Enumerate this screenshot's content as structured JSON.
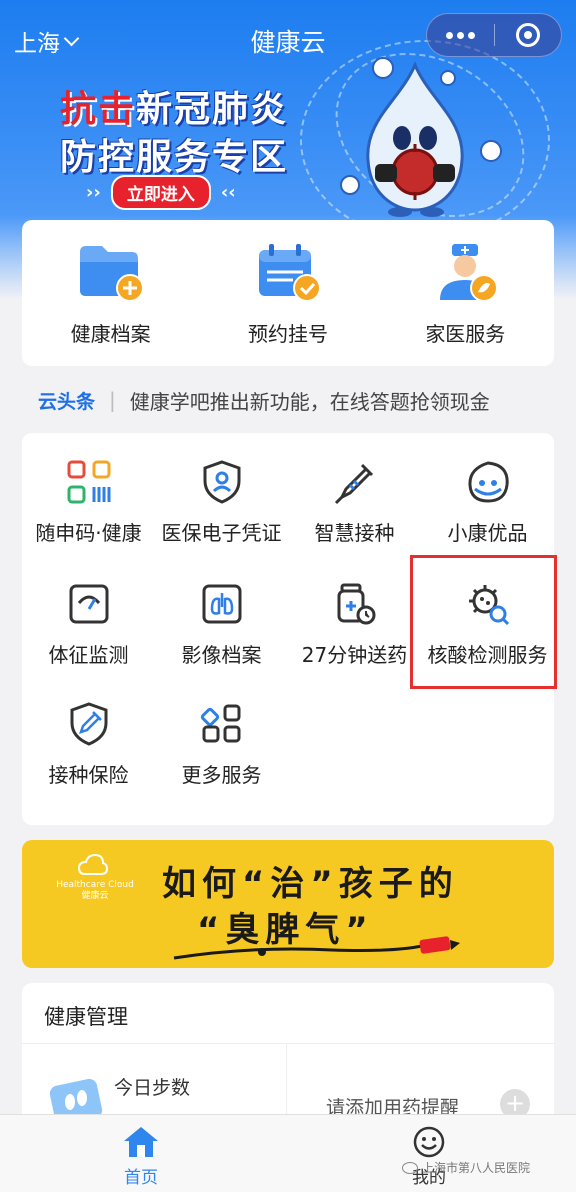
{
  "header": {
    "city": "上海",
    "title": "健康云"
  },
  "banner": {
    "line1_red": "抗击",
    "line1_rest": "新冠肺炎",
    "line2": "防控服务专区",
    "arrows_left": "››",
    "enter_label": "立即进入",
    "arrows_right": "‹‹"
  },
  "quick_actions": [
    {
      "label": "健康档案",
      "icon": "folder-plus-icon"
    },
    {
      "label": "预约挂号",
      "icon": "calendar-check-icon"
    },
    {
      "label": "家医服务",
      "icon": "doctor-icon"
    }
  ],
  "news": {
    "brand": "云头条",
    "separator": "|",
    "text": "健康学吧推出新功能，在线答题抢领现金"
  },
  "services": [
    {
      "label": "随申码·健康",
      "icon": "qr-code-icon"
    },
    {
      "label": "医保电子凭证",
      "icon": "shield-user-icon"
    },
    {
      "label": "智慧接种",
      "icon": "syringe-icon"
    },
    {
      "label": "小康优品",
      "icon": "mascot-icon"
    },
    {
      "label": "体征监测",
      "icon": "gauge-icon"
    },
    {
      "label": "影像档案",
      "icon": "lungs-icon"
    },
    {
      "label": "27分钟送药",
      "icon": "pill-bottle-clock-icon"
    },
    {
      "label": "核酸检测服务",
      "icon": "virus-search-icon"
    },
    {
      "label": "接种保险",
      "icon": "shield-syringe-icon"
    },
    {
      "label": "更多服务",
      "icon": "grid-more-icon"
    }
  ],
  "promo": {
    "logo_text": "Healthcare Cloud",
    "logo_sub": "健康云",
    "line1": "如何“治”孩子的",
    "line2": "“臭脾气”"
  },
  "health": {
    "title": "健康管理",
    "steps_label": "今日步数",
    "med_label": "请添加用药提醒",
    "plus": "+"
  },
  "tabs": [
    {
      "label": "首页",
      "icon": "home-icon",
      "active": true
    },
    {
      "label": "我的",
      "icon": "smiley-icon",
      "active": false
    }
  ],
  "watermark": "上海市第八人民医院",
  "colors": {
    "primary_blue": "#1f7ef0",
    "accent_red": "#e8222d",
    "promo_yellow": "#f6c922",
    "highlight_border": "#e53030"
  }
}
